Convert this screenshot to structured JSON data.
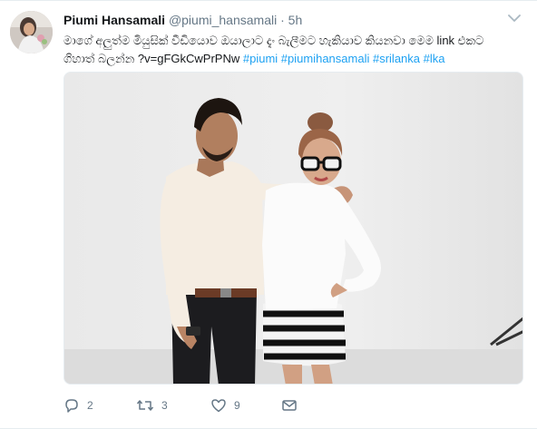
{
  "tweet": {
    "fullname": "Piumi Hansamali",
    "username": "@piumi_hansamali",
    "separator": "·",
    "time": "5h",
    "text_line1": "මාගේ අලුත්ම මියුසික් වීඩියොව ඔයාලාට දැං බැලීමට හැකියාව කියනවා මෙම link එකට",
    "text_line2_prefix": "ගිහාත් බලන්න ?v=gFGkCwPrPNw",
    "hashtags": [
      "#piumi",
      "#piumihansamali",
      "#srilanka",
      "#lka"
    ]
  },
  "actions": {
    "reply_count": "2",
    "retweet_count": "3",
    "like_count": "9"
  },
  "icons": {
    "reply": "reply-icon",
    "retweet": "retweet-icon",
    "like": "heart-icon",
    "caret": "chevron-down-icon"
  },
  "colors": {
    "link": "#1da1f2",
    "meta": "#657786",
    "text": "#14171a"
  }
}
